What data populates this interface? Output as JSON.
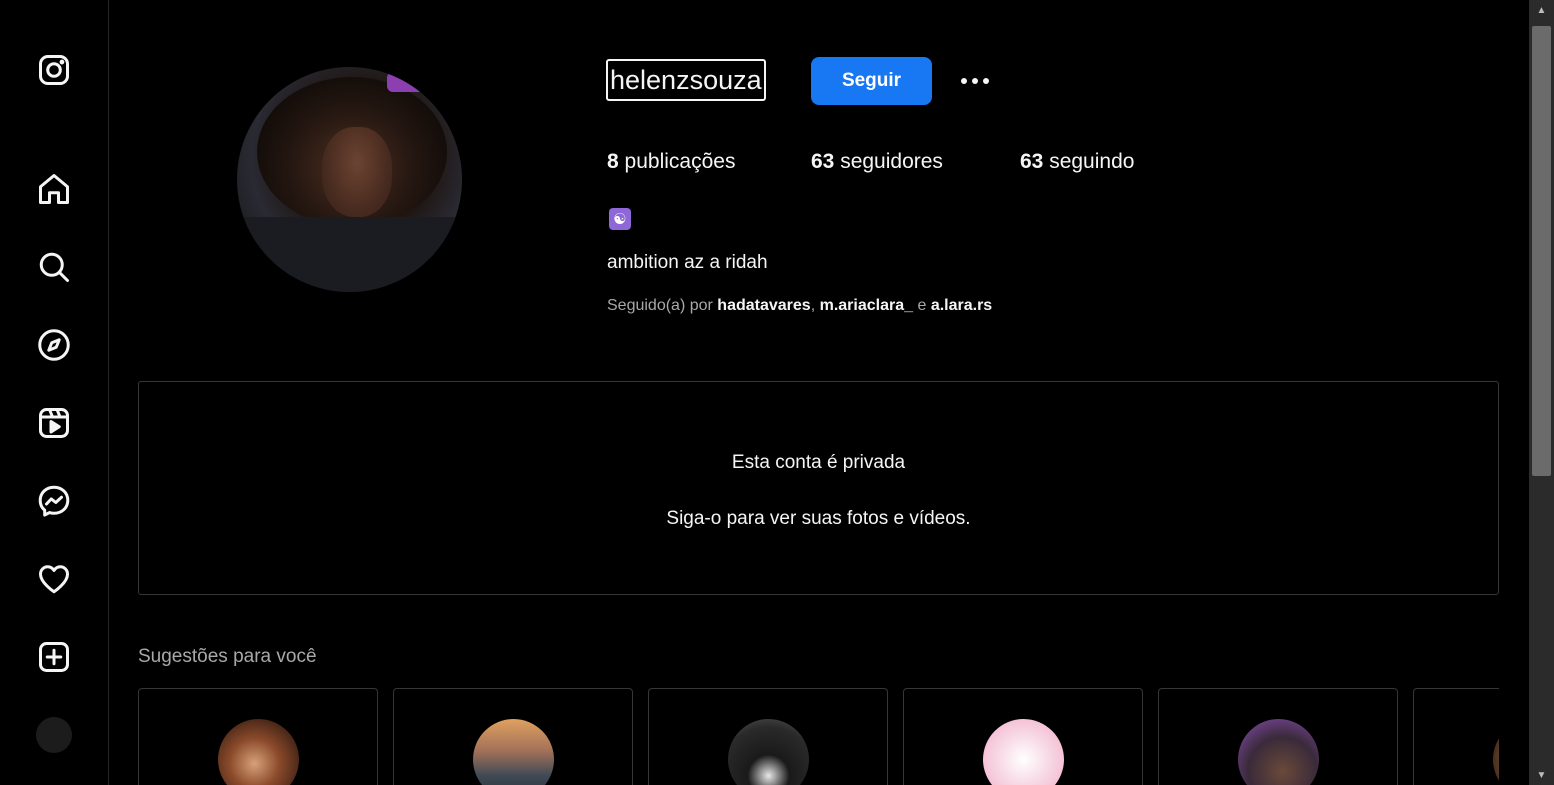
{
  "sidebar": {
    "items": [
      {
        "icon": "instagram-logo-icon"
      },
      {
        "icon": "home-icon"
      },
      {
        "icon": "search-icon"
      },
      {
        "icon": "explore-compass-icon"
      },
      {
        "icon": "reels-icon"
      },
      {
        "icon": "messenger-icon"
      },
      {
        "icon": "heart-icon"
      },
      {
        "icon": "create-plus-icon"
      },
      {
        "icon": "profile-avatar"
      }
    ]
  },
  "profile": {
    "username": "helenzsouza",
    "follow_label": "Seguir",
    "stats": {
      "posts_count": "8",
      "posts_label": "publicações",
      "followers_count": "63",
      "followers_label": "seguidores",
      "following_count": "63",
      "following_label": "seguindo"
    },
    "bio_emoji": "☯",
    "bio": "ambition az a ridah",
    "followed_by_prefix": "Seguido(a) por",
    "followed_by_users": [
      "hadatavares",
      "m.ariaclara_",
      "a.lara.rs"
    ],
    "followed_by_sep": ",",
    "followed_by_and": "e"
  },
  "private_notice": {
    "title": "Esta conta é privada",
    "subtitle": "Siga-o para ver suas fotos e vídeos."
  },
  "suggestions": {
    "title": "Sugestões para você"
  },
  "colors": {
    "background": "#000000",
    "accent": "#1877f2",
    "muted": "#a8a8a8",
    "border": "#363636"
  }
}
